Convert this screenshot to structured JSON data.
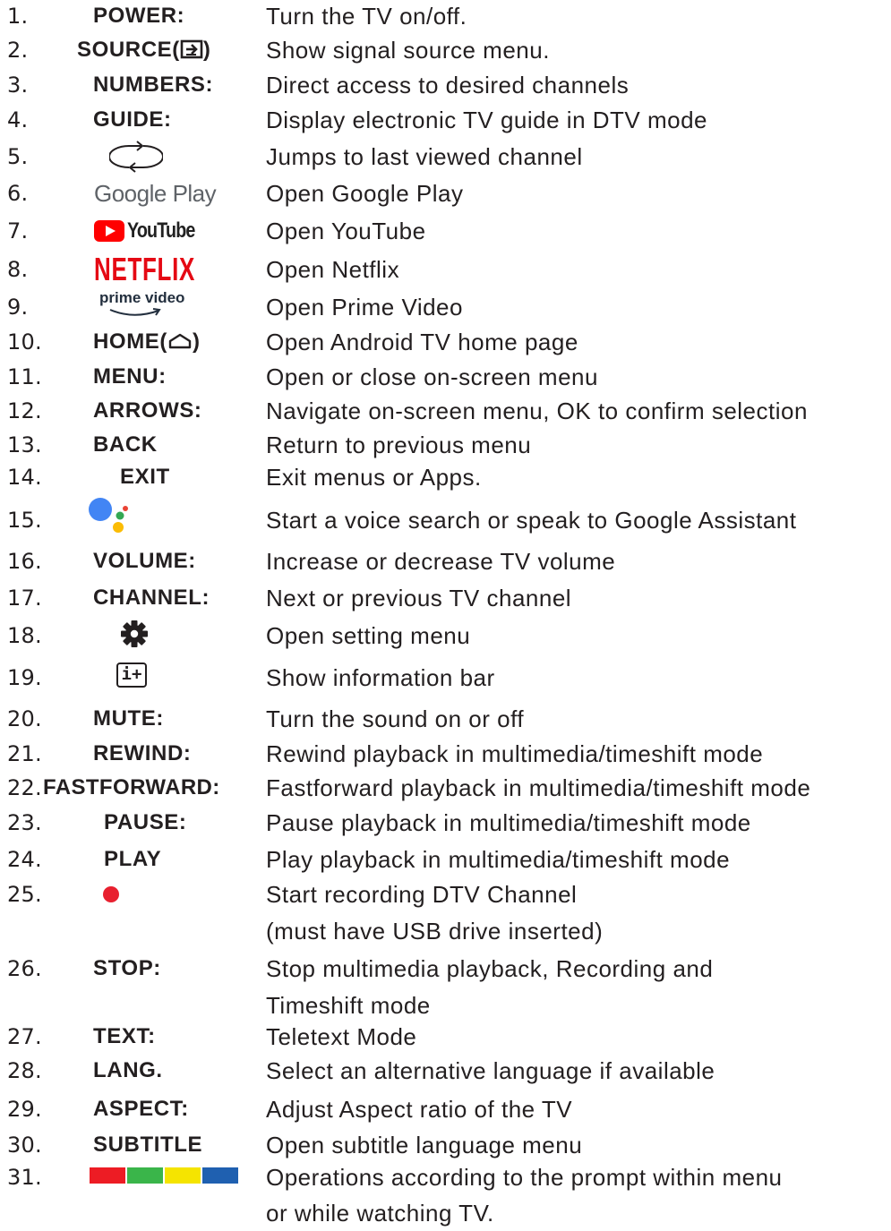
{
  "items": [
    {
      "num": "1.",
      "key": "POWER:",
      "desc": "Turn the TV on/off."
    },
    {
      "num": "2.",
      "key": "SOURCE(",
      "key_suffix": ")",
      "desc": "Show signal source menu."
    },
    {
      "num": "3.",
      "key": "NUMBERS:",
      "desc": "Direct access to desired channels"
    },
    {
      "num": "4.",
      "key": "GUIDE:",
      "desc": "Display electronic TV guide in DTV mode"
    },
    {
      "num": "5.",
      "desc": "Jumps to last viewed channel"
    },
    {
      "num": "6.",
      "logo": "Google Play",
      "desc": "Open Google Play"
    },
    {
      "num": "7.",
      "logo": "YouTube",
      "desc": "Open YouTube"
    },
    {
      "num": "8.",
      "logo": "NETFLIX",
      "desc": "Open Netflix"
    },
    {
      "num": "9.",
      "logo": "prime video",
      "desc": "Open Prime Video"
    },
    {
      "num": "10.",
      "key": "HOME(",
      "key_suffix": ")",
      "desc": "Open Android TV home page"
    },
    {
      "num": "11.",
      "key": "MENU:",
      "desc": "Open or close on-screen menu"
    },
    {
      "num": "12.",
      "key": "ARROWS:",
      "desc": "Navigate on-screen menu, OK to confirm selection"
    },
    {
      "num": "13.",
      "key": "BACK",
      "desc": "Return to previous menu"
    },
    {
      "num": "14.",
      "key": "EXIT",
      "desc": "Exit menus or Apps."
    },
    {
      "num": "15.",
      "desc": "Start a voice search or speak to Google Assistant"
    },
    {
      "num": "16.",
      "key": "VOLUME:",
      "desc": "Increase or decrease TV volume"
    },
    {
      "num": "17.",
      "key": "CHANNEL:",
      "desc": "Next or previous TV channel"
    },
    {
      "num": "18.",
      "desc": "Open setting menu"
    },
    {
      "num": "19.",
      "icon_text": "i+",
      "desc": "Show information bar"
    },
    {
      "num": "20.",
      "key": "MUTE:",
      "desc": "Turn the sound on or off"
    },
    {
      "num": "21.",
      "key": "REWIND:",
      "desc": "Rewind playback in multimedia/timeshift mode"
    },
    {
      "num": "22.",
      "key": "FASTFORWARD:",
      "desc": "Fastforward playback in multimedia/timeshift mode"
    },
    {
      "num": "23.",
      "key": "PAUSE:",
      "desc": "Pause playback in multimedia/timeshift mode"
    },
    {
      "num": "24.",
      "key": "PLAY",
      "desc": "Play playback in multimedia/timeshift mode"
    },
    {
      "num": "25.",
      "desc": "Start recording DTV Channel",
      "desc2": "(must have USB drive inserted)"
    },
    {
      "num": "26.",
      "key": "STOP:",
      "desc": "Stop multimedia playback, Recording and",
      "desc2": "Timeshift mode"
    },
    {
      "num": "27.",
      "key": "TEXT:",
      "desc": "Teletext Mode"
    },
    {
      "num": "28.",
      "key": "LANG.",
      "desc": "Select an alternative language if available"
    },
    {
      "num": "29.",
      "key": "ASPECT:",
      "desc": "Adjust Aspect ratio of the TV"
    },
    {
      "num": "30.",
      "key": "SUBTITLE",
      "desc": "Open subtitle language menu"
    },
    {
      "num": "31.",
      "desc": "Operations according to the prompt within menu",
      "desc2": "or while watching TV."
    }
  ],
  "colors": {
    "text": "#231f20",
    "record_dot": "#e8202f",
    "netflix": "#e50914",
    "youtube": "#ff0000",
    "color_keys": [
      "#ed1c24",
      "#3ab54a",
      "#f5e400",
      "#1f60b0"
    ],
    "assistant": [
      "#4285f4",
      "#ea4335",
      "#fbbc05",
      "#34a853"
    ]
  }
}
